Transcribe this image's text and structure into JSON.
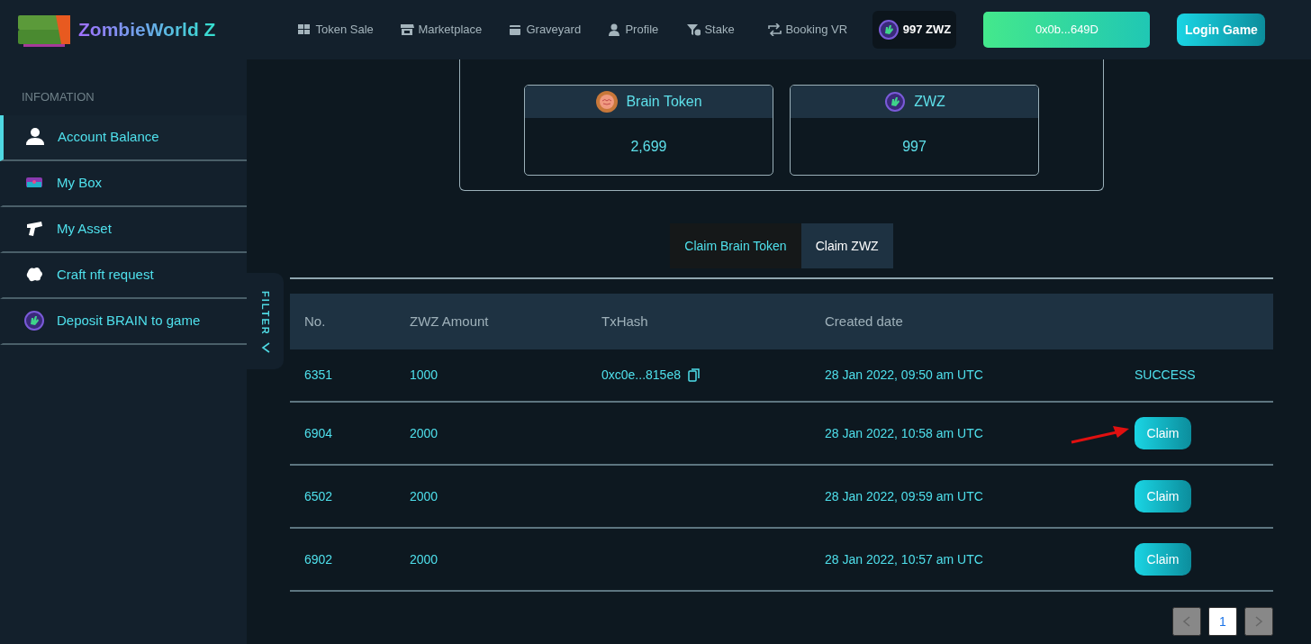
{
  "header": {
    "logo_text": "ZombieWorld Z",
    "nav": [
      {
        "label": "Token Sale"
      },
      {
        "label": "Marketplace"
      },
      {
        "label": "Graveyard"
      },
      {
        "label": "Profile"
      },
      {
        "label": "Stake"
      },
      {
        "label": "Booking VR"
      }
    ],
    "balance_badge": "997 ZWZ",
    "wallet_button": "0x0b...649D",
    "login_button": "Login Game"
  },
  "sidebar": {
    "heading": "INFOMATION",
    "items": [
      {
        "label": "Account Balance",
        "selected": true
      },
      {
        "label": "My Box",
        "selected": false
      },
      {
        "label": "My Asset",
        "selected": false
      },
      {
        "label": "Craft nft request",
        "selected": false
      },
      {
        "label": "Deposit BRAIN to game",
        "selected": false
      }
    ]
  },
  "filter_tab": {
    "label": "FILTER"
  },
  "balances": [
    {
      "name": "Brain Token",
      "value": "2,699"
    },
    {
      "name": "ZWZ",
      "value": "997"
    }
  ],
  "claim_tabs": [
    {
      "label": "Claim Brain Token",
      "selected": false
    },
    {
      "label": "Claim ZWZ",
      "selected": true
    }
  ],
  "table": {
    "columns": [
      "No.",
      "ZWZ Amount",
      "TxHash",
      "Created date"
    ],
    "rows": [
      {
        "no": "6351",
        "amount": "1000",
        "txhash": "0xc0e...815e8",
        "created": "28 Jan 2022, 09:50 am UTC",
        "kind": "status",
        "status": "SUCCESS"
      },
      {
        "no": "6904",
        "amount": "2000",
        "created": "28 Jan 2022, 10:58 am UTC",
        "kind": "action",
        "action": "Claim"
      },
      {
        "no": "6502",
        "amount": "2000",
        "created": "28 Jan 2022, 09:59 am UTC",
        "kind": "action",
        "action": "Claim"
      },
      {
        "no": "6902",
        "amount": "2000",
        "created": "28 Jan 2022, 10:57 am UTC",
        "kind": "action",
        "action": "Claim"
      }
    ]
  },
  "pagination": {
    "pages": [
      {
        "label": "1",
        "selected": true
      }
    ]
  }
}
